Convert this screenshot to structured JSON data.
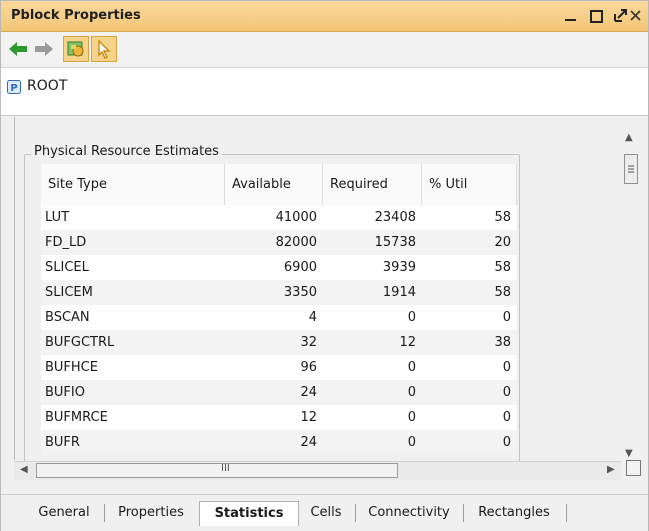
{
  "window": {
    "title": "Pblock Properties",
    "controls": [
      "minimize-icon",
      "maximize-icon",
      "float-icon",
      "close-icon"
    ]
  },
  "toolbar": {
    "icons": [
      "back-arrow-icon",
      "forward-arrow-icon",
      "pblock-icon",
      "select-cursor-icon"
    ]
  },
  "breadcrumb": {
    "badge": "P",
    "label": "ROOT"
  },
  "group": {
    "title": "Physical Resource Estimates"
  },
  "table": {
    "headers": [
      "Site Type",
      "Available",
      "Required",
      "% Util"
    ],
    "rows": [
      {
        "site": "LUT",
        "available": "41000",
        "required": "23408",
        "util": "58"
      },
      {
        "site": "FD_LD",
        "available": "82000",
        "required": "15738",
        "util": "20"
      },
      {
        "site": "SLICEL",
        "available": "6900",
        "required": "3939",
        "util": "58"
      },
      {
        "site": "SLICEM",
        "available": "3350",
        "required": "1914",
        "util": "58"
      },
      {
        "site": "BSCAN",
        "available": "4",
        "required": "0",
        "util": "0"
      },
      {
        "site": "BUFGCTRL",
        "available": "32",
        "required": "12",
        "util": "38"
      },
      {
        "site": "BUFHCE",
        "available": "96",
        "required": "0",
        "util": "0"
      },
      {
        "site": "BUFIO",
        "available": "24",
        "required": "0",
        "util": "0"
      },
      {
        "site": "BUFMRCE",
        "available": "12",
        "required": "0",
        "util": "0"
      },
      {
        "site": "BUFR",
        "available": "24",
        "required": "0",
        "util": "0"
      }
    ]
  },
  "scroll": {
    "h_grip": "III"
  },
  "tabs": [
    {
      "label": "General",
      "active": false
    },
    {
      "label": "Properties",
      "active": false
    },
    {
      "label": "Statistics",
      "active": true
    },
    {
      "label": "Cells",
      "active": false
    },
    {
      "label": "Connectivity",
      "active": false
    },
    {
      "label": "Rectangles",
      "active": false
    }
  ],
  "colors": {
    "titlebar": "#f3c676",
    "toolbar_highlight": "#f5d38a",
    "back_arrow": "#2e9a2e"
  }
}
